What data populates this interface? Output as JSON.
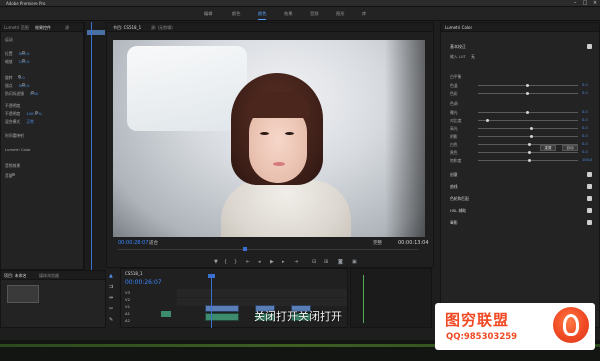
{
  "titlebar": {
    "title": "Adobe Premiere Pro"
  },
  "workspaces": [
    "编辑",
    "颜色",
    "效果",
    "音频",
    "图形",
    "库"
  ],
  "active_workspace": "颜色",
  "effect_controls": {
    "tabs": [
      "效果控件",
      "Lumetri 范围",
      "源"
    ],
    "rows": [
      {
        "label": "运动",
        "value": ""
      },
      {
        "label": "位置",
        "value": "960.0"
      },
      {
        "label": "缩放",
        "value": "100.0"
      },
      {
        "label": "旋转",
        "value": "0.0"
      },
      {
        "label": "锚点",
        "value": "960.0"
      },
      {
        "label": "防闪烁滤镜",
        "value": "0.00"
      },
      {
        "label": "不透明度",
        "value": ""
      },
      {
        "label": "不透明度",
        "value": "100.0 %"
      },
      {
        "label": "混合模式",
        "value": "正常"
      },
      {
        "label": "时间重映射",
        "value": ""
      },
      {
        "label": "Lumetri Color",
        "value": ""
      },
      {
        "label": "音频效果",
        "value": ""
      },
      {
        "label": "音量",
        "value": ""
      }
    ]
  },
  "program": {
    "tabs": [
      "节目: CS518_1",
      "源: (无剪辑)"
    ],
    "timecode_left": "00:00:28:07",
    "fit": "适合",
    "full": "完整",
    "timecode_right": "00:00:13:04"
  },
  "project": {
    "tabs": [
      "项目: 未命名",
      "媒体浏览器"
    ]
  },
  "sequence": {
    "tab": "CS518_1",
    "timecode": "00:00:26:07",
    "tracks": [
      "V3",
      "V2",
      "V1",
      "A1",
      "A2",
      "A3"
    ]
  },
  "lumetri": {
    "tabs": [
      "Lumetri Color"
    ],
    "sections": [
      "基本校正",
      "创意",
      "曲线",
      "色轮和匹配",
      "HSL 辅助",
      "晕影"
    ],
    "rows": [
      {
        "label": "输入 LUT",
        "value": "无"
      },
      {
        "label": "白平衡",
        "value": ""
      },
      {
        "label": "色温",
        "value": "0.0"
      },
      {
        "label": "色彩",
        "value": "0.0"
      },
      {
        "label": "色调",
        "value": ""
      },
      {
        "label": "曝光",
        "value": "0.0"
      },
      {
        "label": "对比度",
        "value": "0.0"
      },
      {
        "label": "高光",
        "value": "0.0"
      },
      {
        "label": "阴影",
        "value": "0.0"
      },
      {
        "label": "白色",
        "value": "0.0"
      },
      {
        "label": "黑色",
        "value": "0.0"
      },
      {
        "label": "饱和度",
        "value": "100.0"
      }
    ],
    "reset": "重置",
    "auto": "自动"
  },
  "subtitle": "关闭打开关闭打开",
  "watermark": {
    "title": "图穷联盟",
    "qq": "QQ:985303259"
  }
}
